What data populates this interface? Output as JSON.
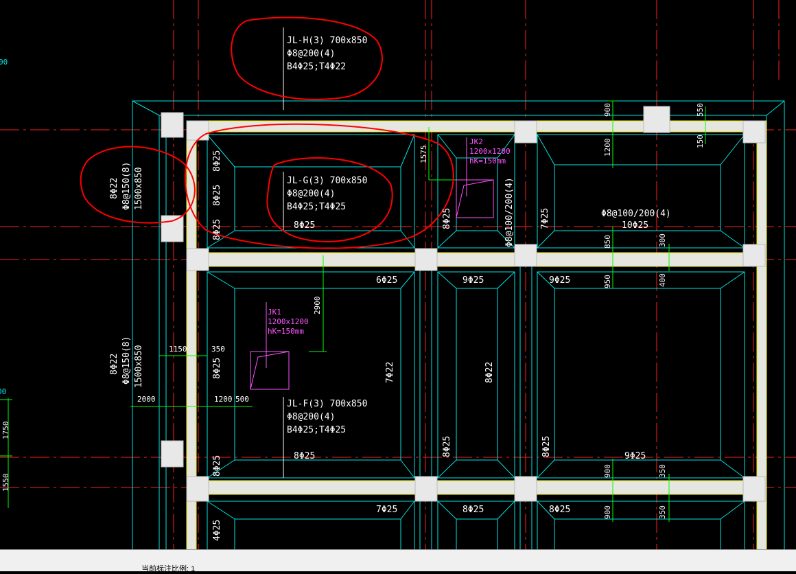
{
  "annotations": {
    "beam_h": {
      "l1": "JL-H(3) 700x850",
      "l2": "Φ8@200(4)",
      "l3": "B4Φ25;T4Φ22"
    },
    "beam_g": {
      "l1": "JL-G(3) 700x850",
      "l2": "Φ8@200(4)",
      "l3": "B4Φ25;T4Φ25"
    },
    "beam_f": {
      "l1": "JL-F(3) 700x850",
      "l2": "Φ8@200(4)",
      "l3": "B4Φ25;T4Φ25"
    },
    "left_beam_top": {
      "l1": "8Φ22",
      "l2": "Φ8@150(8)",
      "l3": "1500x850"
    },
    "left_beam_mid": {
      "l1": "8Φ22",
      "l2": "Φ8@150(8)",
      "l3": "1500x850"
    },
    "jk1": {
      "l1": "JK1",
      "l2": "1200x1200",
      "l3": "hK=150mm"
    },
    "jk2": {
      "l1": "JK2",
      "l2": "1200x1200",
      "l3": "hK=150mm"
    },
    "right_stirrup": {
      "l1": "Φ8@100/200(4)",
      "l2": "10Φ25"
    },
    "mid_stirrup": "Φ8@100/200(4)"
  },
  "rebar_labels": {
    "r1": "8Φ25",
    "r2": "8Φ25",
    "r3": "8Φ25",
    "r4": "8Φ25",
    "r5": "6Φ25",
    "r6": "9Φ25",
    "r7": "9Φ25",
    "r8": "7Φ22",
    "r9": "8Φ22",
    "r10": "8Φ25",
    "r11": "8Φ25",
    "r12": "8Φ25",
    "r13": "8Φ25",
    "r14": "9Φ25",
    "r15": "7Φ25",
    "r16": "8Φ25",
    "r17": "8Φ25",
    "r18": "4Φ25",
    "r19": "7Φ25",
    "r20": "8Φ25",
    "r21": "8Φ25"
  },
  "dimensions": {
    "d900a": "900",
    "d550": "550",
    "d1200": "1200",
    "d150": "150",
    "d1575": "1575",
    "d850": "850",
    "d300": "300",
    "d950": "950",
    "d400": "400",
    "d2900": "2900",
    "d1150": "1150",
    "d350a": "350",
    "d2000": "2000",
    "d1200b": "1200",
    "d500": "500",
    "d900b": "900",
    "d350b": "350",
    "d900c": "900",
    "d350c": "350",
    "left_00a": "00",
    "left_00b": "00",
    "left_1750": "1750",
    "left_1550": "1550"
  },
  "status": {
    "scale_text": "当前标注比例: 1"
  },
  "colors": {
    "cad_cyan": "#00e5e5",
    "cad_red_axis": "#ff2020",
    "markup_red": "#ff0000",
    "dim_green": "#00ff00",
    "label_magenta": "#ff55ff",
    "column_fill": "#e8e8e8",
    "beam_fill": "#e6e6e0"
  }
}
